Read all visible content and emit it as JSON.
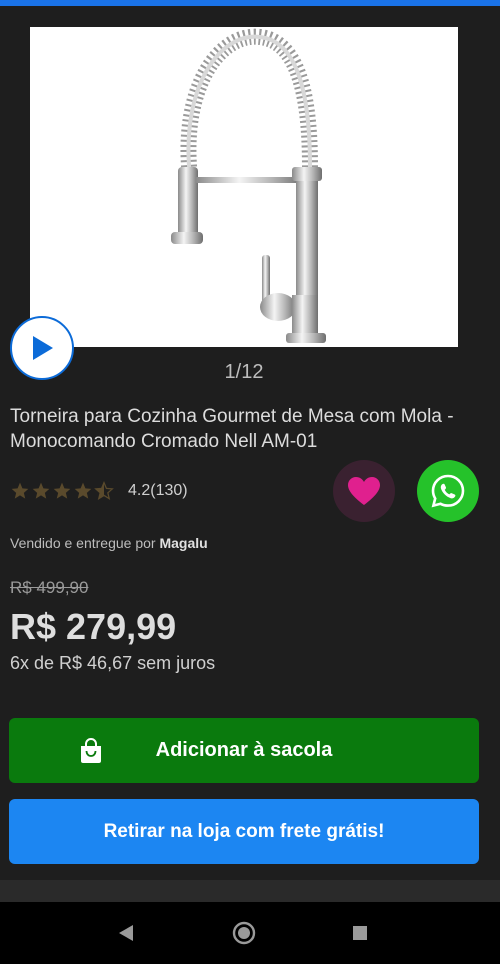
{
  "product": {
    "image_counter": "1/12",
    "title": "Torneira para Cozinha Gourmet de Mesa com Mola - Monocomando Cromado Nell AM-01",
    "rating": 4.2,
    "rating_text": "4.2(130)",
    "seller_prefix": "Vendido e entregue por ",
    "seller_name": "Magalu",
    "old_price": "R$ 499,90",
    "price": "R$ 279,99",
    "installments": "6x de R$ 46,67 sem juros"
  },
  "actions": {
    "add_to_bag": "Adicionar à sacola",
    "pickup": "Retirar na loja com frete grátis!"
  },
  "colors": {
    "accent_blue": "#1c86f2",
    "add_green": "#0a7a0d",
    "heart_pink": "#e0208e",
    "whatsapp_green": "#25c22a",
    "star_color": "#5a4a2c"
  },
  "icons": {
    "play": "play-icon",
    "favorite": "heart-icon",
    "share": "whatsapp-icon",
    "bag": "shopping-bag-icon",
    "back": "back-triangle-icon",
    "home": "home-circle-icon",
    "recents": "recents-square-icon"
  }
}
